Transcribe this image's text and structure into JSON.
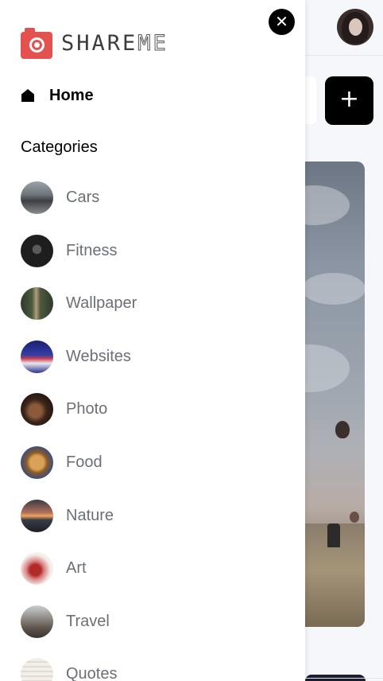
{
  "app": {
    "logo_text_a": "SHARE",
    "logo_text_b": "ME"
  },
  "header": {
    "add_label": "+",
    "close_label": "✕"
  },
  "drawer": {
    "home_label": "Home",
    "categories_heading": "Categories",
    "categories": [
      {
        "label": "Cars",
        "thumb": "cars-thumbnail"
      },
      {
        "label": "Fitness",
        "thumb": "fitness-thumbnail"
      },
      {
        "label": "Wallpaper",
        "thumb": "wallpaper-thumbnail"
      },
      {
        "label": "Websites",
        "thumb": "websites-thumbnail"
      },
      {
        "label": "Photo",
        "thumb": "photo-thumbnail"
      },
      {
        "label": "Food",
        "thumb": "food-thumbnail"
      },
      {
        "label": "Nature",
        "thumb": "nature-thumbnail"
      },
      {
        "label": "Art",
        "thumb": "art-thumbnail"
      },
      {
        "label": "Travel",
        "thumb": "travel-thumbnail"
      },
      {
        "label": "Quotes",
        "thumb": "quotes-thumbnail"
      }
    ]
  },
  "colors": {
    "brand": "#e5514e",
    "category_text": "#6b6f76",
    "background": "#f6f7fa"
  }
}
